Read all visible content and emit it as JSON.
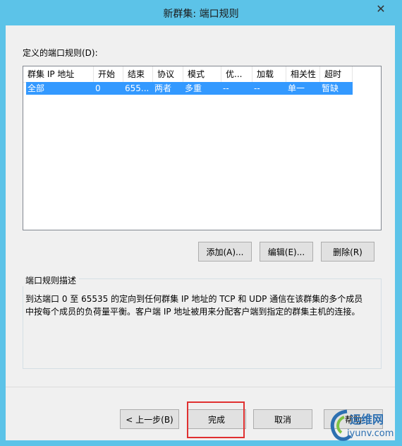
{
  "window": {
    "title": "新群集: 端口规则"
  },
  "rules": {
    "label": "定义的端口规则(D):",
    "columns": [
      "群集 IP 地址",
      "开始",
      "结束",
      "协议",
      "模式",
      "优...",
      "加载",
      "相关性",
      "超时"
    ],
    "rows": [
      [
        "全部",
        "0",
        "655...",
        "两者",
        "多重",
        "--",
        "--",
        "单一",
        "暂缺"
      ]
    ]
  },
  "actions": {
    "add": "添加(A)...",
    "edit": "编辑(E)...",
    "delete": "删除(R)"
  },
  "description": {
    "title": "端口规则描述",
    "text": "到达端口 0 至 65535 的定向到任何群集 IP 地址的 TCP 和 UDP 通信在该群集的多个成员中按每个成员的负荷量平衡。客户端 IP 地址被用来分配客户端到指定的群集主机的连接。"
  },
  "footer": {
    "back": "< 上一步(B)",
    "finish": "完成",
    "cancel": "取消",
    "help": "帮助"
  },
  "watermark": {
    "name": "运维网",
    "domain": "iyunv.com"
  },
  "colors": {
    "titlebar": "#5cc3e8",
    "selection": "#3399ff",
    "highlight": "#e03030"
  }
}
